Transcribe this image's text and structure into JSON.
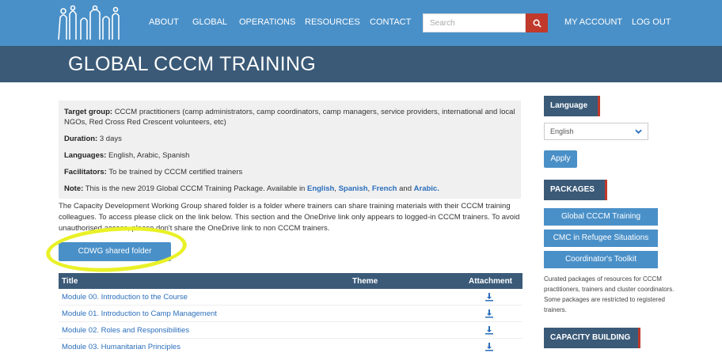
{
  "nav": {
    "items": [
      "ABOUT",
      "GLOBAL",
      "OPERATIONS",
      "RESOURCES",
      "CONTACT"
    ],
    "search_placeholder": "Search",
    "account": "MY ACCOUNT",
    "logout": "LOG OUT"
  },
  "page_title": "GLOBAL CCCM TRAINING",
  "info": {
    "target_label": "Target group:",
    "target_text": "CCCM practitioners (camp administrators, camp coordinators, camp managers, service providers, international and local NGOs, Red Cross Red Crescent volunteers, etc)",
    "duration_label": "Duration:",
    "duration_text": "3 days",
    "languages_label": "Languages:",
    "languages_text": "English, Arabic, Spanish",
    "facilitators_label": "Facilitators:",
    "facilitators_text": "To be trained by CCCM certified trainers",
    "note_label": "Note:",
    "note_text": "This is the new 2019 Global CCCM Training Package. Available in",
    "note_links": [
      "English",
      "Spanish",
      "French",
      "Arabic."
    ],
    "note_and": "and"
  },
  "paragraph": "The Capacity Development Working Group shared folder is a folder where trainers can share training materials with their CCCM training colleagues. To access please click on the link below. This section and the OneDrive link only appears to logged-in CCCM trainers. To avoid unauthorised access, please don't share the OneDrive link to non CCCM trainers.",
  "cdwg_button": "CDWG shared folder",
  "table": {
    "headers": [
      "Title",
      "Theme",
      "Attachment"
    ],
    "rows": [
      "Module 00. Introduction to the Course",
      "Module 01. Introduction to Camp Management",
      "Module 02. Roles and Responsibilities",
      "Module 03. Humanitarian Principles"
    ]
  },
  "sidebar": {
    "language_heading": "Language",
    "language_selected": "English",
    "apply": "Apply",
    "packages_heading": "PACKAGES",
    "packages": [
      "Global CCCM Training",
      "CMC in Refugee Situations",
      "Coordinator's Toolkit"
    ],
    "packages_note": "Curated packages of resources for CCCM practitioners, trainers and cluster coordinators. Some packages are restricted to registered trainers.",
    "capacity_heading": "CAPACITY BUILDING"
  },
  "colors": {
    "nav_blue": "#4a90c8",
    "banner_navy": "#3a5a78",
    "search_red": "#c0392b",
    "highlight_yellow": "#e9f127"
  }
}
